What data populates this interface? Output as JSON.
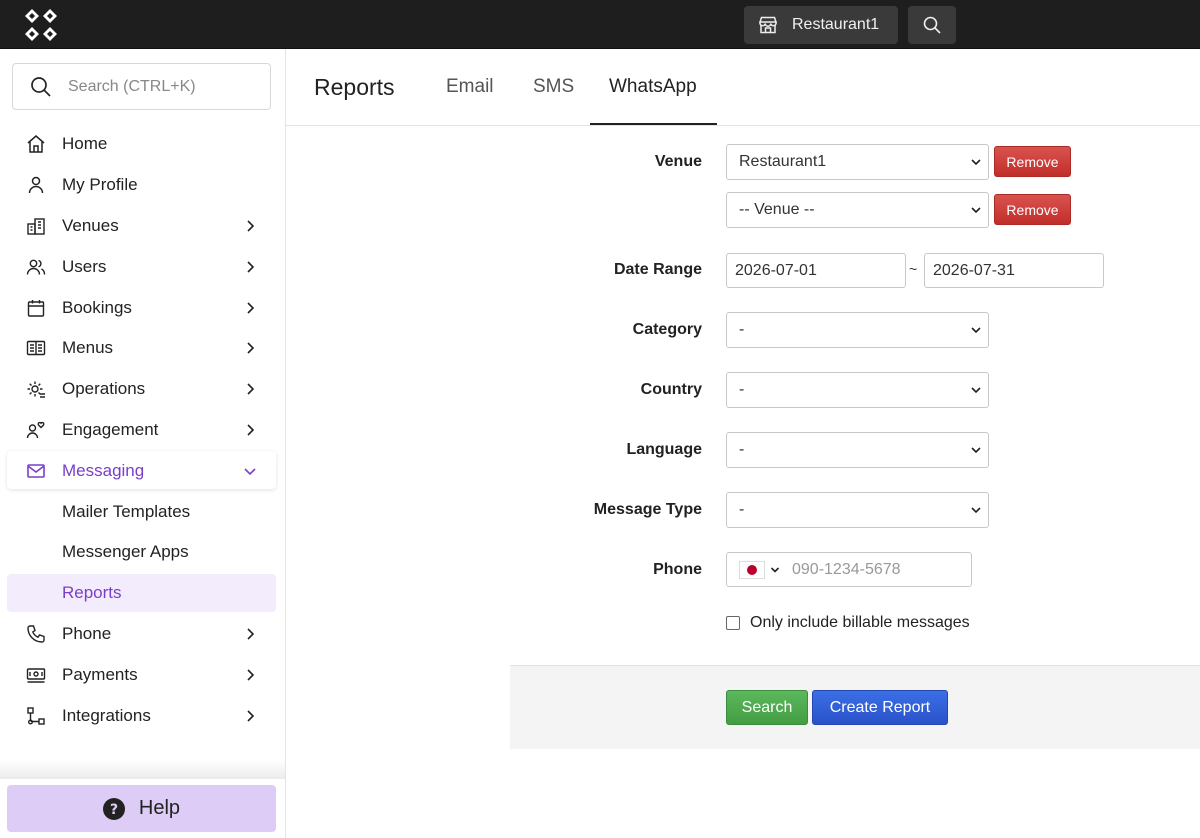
{
  "topbar": {
    "venue_label": "Restaurant1"
  },
  "sidebar": {
    "search_placeholder": "Search (CTRL+K)",
    "items": [
      {
        "label": "Home",
        "icon": "home-icon",
        "has_children": false
      },
      {
        "label": "My Profile",
        "icon": "user-icon",
        "has_children": false
      },
      {
        "label": "Venues",
        "icon": "building-icon",
        "has_children": true
      },
      {
        "label": "Users",
        "icon": "users-icon",
        "has_children": true
      },
      {
        "label": "Bookings",
        "icon": "calendar-icon",
        "has_children": true
      },
      {
        "label": "Menus",
        "icon": "book-icon",
        "has_children": true
      },
      {
        "label": "Operations",
        "icon": "cog-icon",
        "has_children": true
      },
      {
        "label": "Engagement",
        "icon": "engagement-icon",
        "has_children": true
      },
      {
        "label": "Messaging",
        "icon": "mail-icon",
        "has_children": true,
        "expanded": true
      }
    ],
    "messaging_sub": [
      "Mailer Templates",
      "Messenger Apps",
      "Reports"
    ],
    "items_after": [
      {
        "label": "Phone",
        "icon": "phone-icon"
      },
      {
        "label": "Payments",
        "icon": "payments-icon"
      },
      {
        "label": "Integrations",
        "icon": "integrations-icon"
      }
    ],
    "help_label": "Help",
    "accent_color": "#7a3fc7"
  },
  "header": {
    "title": "Reports",
    "tabs": [
      "Email",
      "SMS",
      "WhatsApp"
    ],
    "active_tab": "WhatsApp"
  },
  "form": {
    "venue_label": "Venue",
    "venue_values": [
      "Restaurant1",
      "-- Venue --"
    ],
    "remove_label": "Remove",
    "date_range_label": "Date Range",
    "date_from": "2026-07-01",
    "date_to": "2026-07-31",
    "date_separator": "~",
    "category_label": "Category",
    "category_value": "-",
    "country_label": "Country",
    "country_value": "-",
    "language_label": "Language",
    "language_value": "-",
    "message_type_label": "Message Type",
    "message_type_value": "-",
    "phone_label": "Phone",
    "phone_placeholder": "090-1234-5678",
    "phone_country_flag": "japan-flag-icon",
    "billable_label": "Only include billable messages",
    "billable_checked": false,
    "search_button": "Search",
    "create_report_button": "Create Report"
  }
}
